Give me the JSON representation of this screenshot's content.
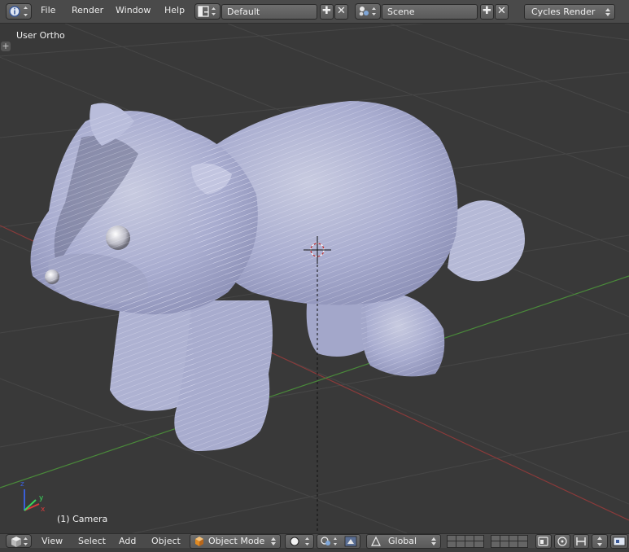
{
  "header": {
    "menus": [
      "File",
      "Render",
      "Window",
      "Help"
    ],
    "layout_name": "Default",
    "scene_name": "Scene",
    "render_engine": "Cycles Render"
  },
  "viewport": {
    "view_label": "User Ortho",
    "object_label": "(1) Camera",
    "axis_labels": {
      "x": "x",
      "y": "y",
      "z": "z"
    }
  },
  "footer": {
    "menus": [
      "View",
      "Select",
      "Add",
      "Object"
    ],
    "mode": "Object Mode",
    "orientation": "Global"
  },
  "colors": {
    "background": "#393939",
    "grid_line": "#4a4a4a",
    "x_axis": "#8a3a3a",
    "y_axis": "#4a8a3a",
    "model": "#b4b8d8",
    "header": "#4a4a4a"
  },
  "icons": [
    "info-icon",
    "screen-layout-icon",
    "add-icon",
    "close-icon",
    "scene-icon",
    "cube-icon",
    "viewport-shading-icon",
    "pivot-icon",
    "manipulator-icon",
    "snap-icon",
    "proportional-icon",
    "camera-icon"
  ]
}
